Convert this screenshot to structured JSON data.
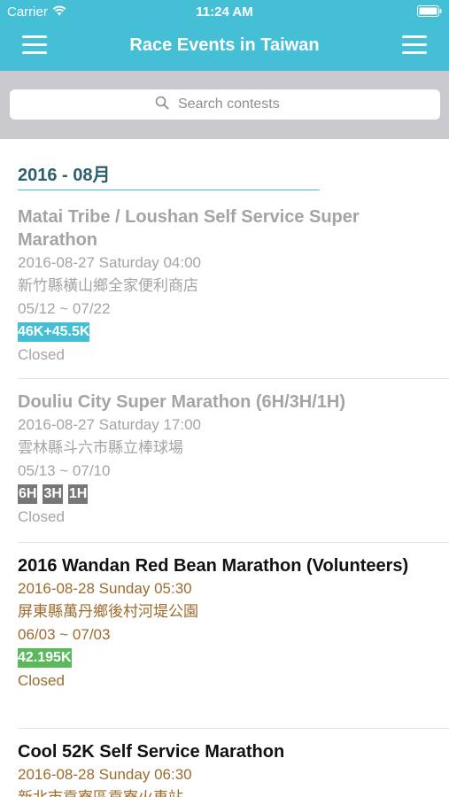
{
  "status_bar": {
    "carrier": "Carrier",
    "time": "11:24 AM"
  },
  "nav": {
    "title": "Race Events in Taiwan"
  },
  "search": {
    "placeholder": "Search contests"
  },
  "section": {
    "header": "2016 - 08月"
  },
  "events": [
    {
      "name": "Matai Tribe / Loushan Self Service Super Marathon",
      "datetime": "2016-08-27 Saturday 04:00",
      "location": "新竹縣橫山鄉全家便利商店",
      "registration": "05/12 ~ 07/22",
      "tags": [
        "46K+45.5K"
      ],
      "status": "Closed"
    },
    {
      "name": "Douliu City Super Marathon (6H/3H/1H)",
      "datetime": "2016-08-27 Saturday 17:00",
      "location": "雲林縣斗六市縣立棒球場",
      "registration": "05/13 ~ 07/10",
      "tags": [
        "6H",
        "3H",
        "1H"
      ],
      "status": "Closed"
    },
    {
      "name": "2016 Wandan Red Bean Marathon (Volunteers)",
      "datetime": "2016-08-28 Sunday 05:30",
      "location": "屏東縣萬丹鄉後村河堤公園",
      "registration": "06/03 ~ 07/03",
      "tags": [
        "42.195K"
      ],
      "status": "Closed"
    },
    {
      "name": "Cool 52K Self Service Marathon",
      "datetime": "2016-08-28 Sunday 06:30",
      "location": "新北市貢寮區貢寮火車站"
    }
  ],
  "colors": {
    "accent": "#45bfd6",
    "search_bg": "#c9c9ce",
    "open_detail": "#9c6b2e",
    "closed_text": "#a4a4a4",
    "tag_blue": "#45bfd6",
    "tag_gray": "#777777",
    "tag_green": "#5cb85c"
  },
  "icons": {
    "wifi": "wifi-icon",
    "battery": "battery-icon",
    "menu": "menu-icon",
    "search": "search-icon"
  }
}
